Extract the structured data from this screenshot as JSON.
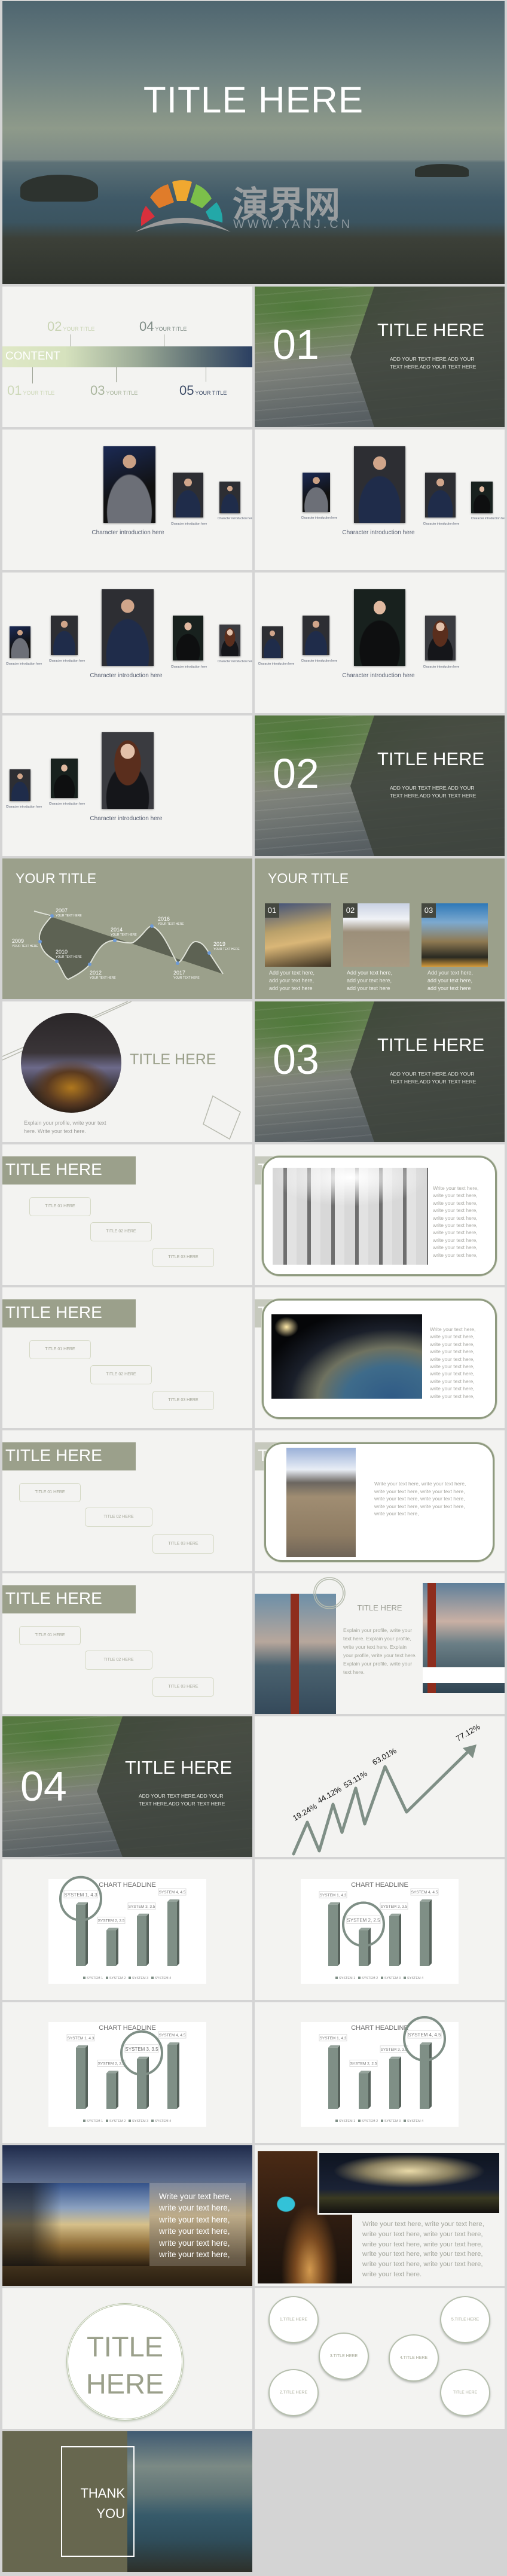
{
  "colors": {
    "olive": "#9ba08b",
    "dark_overlay": "#3c423a",
    "chart_bar": "#7f8f86",
    "thanks_panel": "#67674f",
    "slide_bg": "#f3f3f1"
  },
  "hero": {
    "title": "TITLE HERE",
    "watermark_cn": "演界网",
    "watermark_url": "WWW.YANJ.CN"
  },
  "contents": {
    "label": "CONTENT",
    "items": [
      {
        "num": "01",
        "label": "YOUR TITLE"
      },
      {
        "num": "02",
        "label": "YOUR TITLE"
      },
      {
        "num": "03",
        "label": "YOUR TITLE"
      },
      {
        "num": "04",
        "label": "YOUR TITLE"
      },
      {
        "num": "05",
        "label": "YOUR TITLE"
      }
    ]
  },
  "sections": [
    {
      "num": "01",
      "title": "TITLE HERE",
      "line1": "ADD YOUR TEXT HERE,ADD YOUR",
      "line2": "TEXT HERE,ADD YOUR TEXT HERE"
    },
    {
      "num": "02",
      "title": "TITLE HERE",
      "line1": "ADD YOUR TEXT HERE,ADD YOUR",
      "line2": "TEXT HERE,ADD YOUR TEXT HERE"
    },
    {
      "num": "03",
      "title": "TITLE HERE",
      "line1": "ADD YOUR TEXT HERE,ADD YOUR",
      "line2": "TEXT HERE,ADD YOUR TEXT HERE"
    },
    {
      "num": "04",
      "title": "TITLE HERE",
      "line1": "ADD YOUR TEXT HERE,ADD YOUR",
      "line2": "TEXT HERE,ADD YOUR TEXT HERE"
    }
  ],
  "team": {
    "caption": "Character introduction here"
  },
  "timeline": {
    "title": "YOUR TITLE",
    "points": [
      {
        "year": "2007",
        "text": "YOUR TEXT HERE"
      },
      {
        "year": "2009",
        "text": "YOUR TEXT HERE"
      },
      {
        "year": "2010",
        "text": "YOUR TEXT HERE"
      },
      {
        "year": "2012",
        "text": "YOUR TEXT HERE"
      },
      {
        "year": "2014",
        "text": "YOUR TEXT HERE"
      },
      {
        "year": "2016",
        "text": "YOUR TEXT HERE"
      },
      {
        "year": "2017",
        "text": "YOUR TEXT HERE"
      },
      {
        "year": "2019",
        "text": "YOUR TEXT HERE"
      }
    ]
  },
  "gallery": {
    "title": "YOUR TITLE",
    "items": [
      {
        "num": "01",
        "l1": "Add your text here,",
        "l2": "add your text here,",
        "l3": "add your text here"
      },
      {
        "num": "02",
        "l1": "Add your text here,",
        "l2": "add your text here,",
        "l3": "add your text here"
      },
      {
        "num": "03",
        "l1": "Add your text here,",
        "l2": "add your text here,",
        "l3": "add your text here"
      }
    ]
  },
  "profile": {
    "title": "TITLE HERE",
    "line1": "Explain your profile, write your text",
    "line2": "here. Write your text here."
  },
  "steps": {
    "title": "TITLE HERE",
    "items": [
      "TITLE 01 HERE",
      "TITLE 02 HERE",
      "TITLE 03 HERE"
    ]
  },
  "cards": {
    "lines": [
      "Write your text here,",
      "write your text here,",
      "write your text here,",
      "write your text here,",
      "write your text here,",
      "write your text here,",
      "write your text here,",
      "write your text here,",
      "write your text here,",
      "write your text here,"
    ],
    "castle_text": "Write your text here, write your text here, write your text here, write your text here, write your text here, write your text here, write your text here, write your text here, write your text here,"
  },
  "bridge": {
    "title": "TITLE HERE",
    "text": "Explain your profile, write your text here. Explain your profile, write your text here. Explain your profile, write your text here. Explain your profile, write your text here."
  },
  "tower": {
    "lines": [
      "Write your text here,",
      "write your text here,",
      "write your text here,",
      "write your text here,",
      "write your text here,",
      "write your text here,"
    ]
  },
  "eiffel": {
    "text": "Write your text here, write your text here, write your text here, write your text here, write your text here, write your text here, write your text here, write your text here, write your text here, write your text here, write your text here."
  },
  "title_circle": {
    "line1": "TITLE",
    "line2": "HERE"
  },
  "bubbles": [
    "1.TITLE HERE",
    "2.TITLE HERE",
    "3.TITLE HERE",
    "4.TITLE HERE",
    "5.TITLE HERE",
    "TITLE HERE"
  ],
  "thanks": {
    "line1": "THANK",
    "line2": "YOU"
  },
  "chart_data": [
    {
      "type": "line",
      "values": [
        19.24,
        44.12,
        53.11,
        63.01,
        77.12
      ],
      "labels": [
        "19.24%",
        "44.12%",
        "53.11%",
        "63.01%",
        "77.12%"
      ]
    },
    {
      "type": "bar",
      "title": "CHART HEADLINE",
      "categories": [
        "SYSTEM 1",
        "SYSTEM 2",
        "SYSTEM 3",
        "SYSTEM 4"
      ],
      "values": [
        4.3,
        2.5,
        3.5,
        4.5
      ],
      "data_labels": [
        "SYSTEM 1, 4.3",
        "SYSTEM 2, 2.5",
        "SYSTEM 3, 3.5",
        "SYSTEM 4, 4.5"
      ],
      "highlight": "SYSTEM 1",
      "legend": "bottom",
      "grid": false
    },
    {
      "type": "bar",
      "title": "CHART HEADLINE",
      "categories": [
        "SYSTEM 1",
        "SYSTEM 2",
        "SYSTEM 3",
        "SYSTEM 4"
      ],
      "values": [
        4.3,
        2.5,
        3.5,
        4.5
      ],
      "data_labels": [
        "SYSTEM 1, 4.3",
        "SYSTEM 2, 2.5",
        "SYSTEM 3, 3.5",
        "SYSTEM 4, 4.5"
      ],
      "highlight": "SYSTEM 2",
      "legend": "bottom",
      "grid": false
    },
    {
      "type": "bar",
      "title": "CHART HEADLINE",
      "categories": [
        "SYSTEM 1",
        "SYSTEM 2",
        "SYSTEM 3",
        "SYSTEM 4"
      ],
      "values": [
        4.3,
        2.5,
        3.5,
        4.5
      ],
      "data_labels": [
        "SYSTEM 1, 4.3",
        "SYSTEM 2, 2.5",
        "SYSTEM 3, 3.5",
        "SYSTEM 4, 4.5"
      ],
      "highlight": "SYSTEM 3",
      "legend": "bottom",
      "grid": false
    },
    {
      "type": "bar",
      "title": "CHART HEADLINE",
      "categories": [
        "SYSTEM 1",
        "SYSTEM 2",
        "SYSTEM 3",
        "SYSTEM 4"
      ],
      "values": [
        4.3,
        2.5,
        3.5,
        4.5
      ],
      "data_labels": [
        "SYSTEM 1, 4.3",
        "SYSTEM 2, 2.5",
        "SYSTEM 3, 3.5",
        "SYSTEM 4, 4.5"
      ],
      "highlight": "SYSTEM 4",
      "legend": "bottom",
      "grid": false
    }
  ]
}
